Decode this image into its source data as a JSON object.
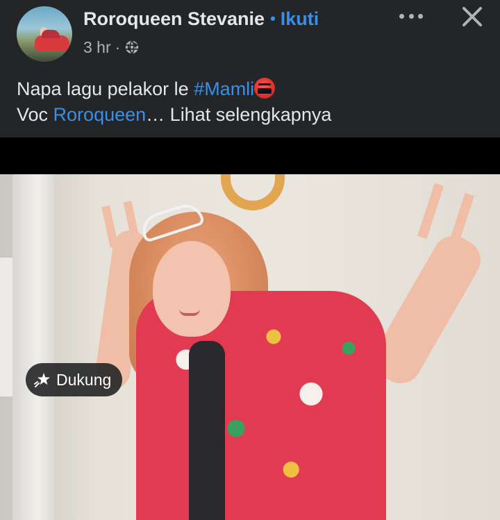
{
  "post": {
    "author_name": "Roroqueen Stevanie",
    "separator_dot": "•",
    "follow_label": "Ikuti",
    "timestamp": "3 hr",
    "meta_separator": "·",
    "privacy_icon": "globe-icon",
    "more_icon": "more-horizontal-icon",
    "close_icon": "close-icon"
  },
  "caption": {
    "line1_text": "Napa lagu pelakor le ",
    "hashtag": "#Mamli",
    "emoji": "angry-face-with-symbols-emoji",
    "line2_prefix": "Voc ",
    "mention": "Roroqueen",
    "ellipsis": "… ",
    "see_more": "Lihat selengkapnya"
  },
  "video": {
    "support_label": "Dukung",
    "support_icon": "star-icon"
  },
  "colors": {
    "background": "#242526",
    "accent_link": "#3a8fe8",
    "text_primary": "#e4e6eb",
    "text_secondary": "#b0b3b8",
    "video_letterbox": "#000000"
  }
}
